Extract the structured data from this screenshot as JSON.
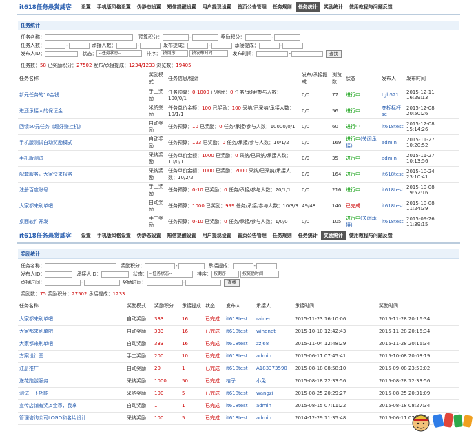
{
  "nav1": {
    "logo": "it618任务悬赏威客",
    "items": [
      "设置",
      "手机版风格设置",
      "伪静态设置",
      "短信提醒设置",
      "用户提现设置",
      "首页公告管理",
      "任务规则",
      "任务统计",
      "奖励统计",
      "使用教程与问题反馈"
    ]
  },
  "task": {
    "section": "任务统计",
    "form": {
      "name": "任务名称：",
      "budget": "预算积分：",
      "reward": "奖励积分：",
      "count": "任务人数：",
      "accepter": "承接人数：",
      "pubcash": "发布提成：",
      "acccash": "承接提成：",
      "pubid": "发布人ID：",
      "status": "状态：",
      "status_sel": "--任务状态--",
      "sort": "排序：",
      "sort_sel": "按倒序",
      "sortby_sel": "按发布时间",
      "pubtime": "发布时间：",
      "search": "查找"
    },
    "summary": {
      "l1": "任务数：",
      "v1": "58",
      "l2": " 已奖励积分：",
      "v2": "27502",
      "l3": " 发布/承接提成：",
      "v3": "1234/1233",
      "l4": " 浏览数：",
      "v4": "19405"
    },
    "headers": [
      "任务名称",
      "奖励模式",
      "任务信息/统计",
      "发布/承接提成",
      "浏览数",
      "状态",
      "发布人",
      "发布时间"
    ],
    "rows": [
      {
        "name": "新元任务的10金钱",
        "mode": "手工奖励",
        "i1": "任务预算：",
        "i2": "0-1000",
        "i3": " 已奖励：",
        "i4": "0",
        "i5": " 任务/承接/参与人数：100/0/1",
        "comm": "0/0",
        "views": "77",
        "status": "进行中",
        "act": "",
        "pub": "tgh521",
        "time": "2015-12-11 16:29:13"
      },
      {
        "name": "进还承接人的保证金",
        "mode": "采纳奖励",
        "i1": "任务单价金额：",
        "i2": "100",
        "i3": " 已奖励：",
        "i4": "100",
        "i5": " 采纳/已采纳/承接人数：10/1/1",
        "comm": "0/0",
        "views": "56",
        "status": "进行中",
        "act": "",
        "pub": "夺标标杆se",
        "time": "2015-12-08 20:50:26"
      },
      {
        "name": "回馈50元任务《超好赚挂机》",
        "mode": "自动奖励",
        "i1": "任务预算：",
        "i2": "10",
        "i3": " 已奖励：",
        "i4": "0",
        "i5": " 任务/承接/参与人数：10000/0/1",
        "comm": "0/0",
        "views": "60",
        "status": "进行中",
        "act": "",
        "pub": "it618test",
        "time": "2015-12-08 15:14:26"
      },
      {
        "name": "手机版测试自动奖励模式",
        "mode": "自动奖励",
        "i1": "任务预算：",
        "i2": "123",
        "i3": " 已奖励：",
        "i4": "0",
        "i5": " 任务/承接/参与人数：10/1/2",
        "comm": "0/0",
        "views": "169",
        "status": "进行中",
        "act": "(关闭承接)",
        "pub": "admin",
        "time": "2015-11-27 10:20:52"
      },
      {
        "name": "手机版测试",
        "mode": "采纳奖励",
        "i1": "任务单价金额：",
        "i2": "1000",
        "i3": " 已奖励：",
        "i4": "0",
        "i5": " 采纳/已采纳/承接人数：10/0/1",
        "comm": "0/0",
        "views": "35",
        "status": "进行中",
        "act": "",
        "pub": "admin",
        "time": "2015-11-27 10:13:56"
      },
      {
        "name": "配套服务，大家快来报名",
        "mode": "采纳奖励",
        "i1": "任务单价金额：",
        "i2": "1000",
        "i3": " 已奖励：",
        "i4": "2000",
        "i5": " 采纳/已采纳/承接人数：10/2/3",
        "comm": "0/0",
        "views": "164",
        "status": "进行中",
        "act": "",
        "pub": "it618test",
        "time": "2015-10-24 23:10:41"
      },
      {
        "name": "注册百度账号",
        "mode": "手工奖励",
        "i1": "任务预算：",
        "i2": "0-10",
        "i3": " 已奖励：",
        "i4": "0",
        "i5": " 任务/承接/参与人数：20/1/1",
        "comm": "0/0",
        "views": "216",
        "status": "进行中",
        "act": "",
        "pub": "it618test",
        "time": "2015-10-08 19:52:16"
      },
      {
        "name": "大家都来刷单吧",
        "mode": "自动奖励",
        "i1": "任务预算：",
        "i2": "1000",
        "i3": " 已奖励：",
        "i4": "999",
        "i5": " 任务/承接/参与人数：10/3/3",
        "comm": "49/48",
        "views": "140",
        "status": "已完成",
        "act": "",
        "pub": "it618test",
        "time": "2015-10-08 11:24:39"
      },
      {
        "name": "桌面软件开发",
        "mode": "手工奖励",
        "i1": "任务预算：",
        "i2": "0-10",
        "i3": " 已奖励：",
        "i4": "0",
        "i5": " 任务/承接/参与人数：1/0/0",
        "comm": "0/0",
        "views": "105",
        "status": "进行中",
        "act": "(关闭承接)",
        "pub": "it618test",
        "time": "2015-09-26 11:39:15"
      }
    ]
  },
  "nav2": {
    "logo": "it618任务悬赏威客",
    "items": [
      "设置",
      "手机版风格设置",
      "伪静态设置",
      "短信提醒设置",
      "用户提现设置",
      "首页公告管理",
      "任务规则",
      "任务统计",
      "奖励统计",
      "使用教程与问题反馈"
    ]
  },
  "reward": {
    "section": "奖励统计",
    "form": {
      "name": "任务名称：",
      "reward": "奖励积分：",
      "acccash": "承接提成：",
      "pubid": "发布人ID：",
      "accid": "承接人ID：",
      "status": "状态：",
      "status_sel": "--任务状态--",
      "sort": "排序：",
      "sort_sel": "按倒序",
      "sortby_sel": "按奖励时间",
      "acctime": "承接时间：",
      "rewtime": "奖励时间：",
      "search": "查找"
    },
    "summary": {
      "l1": "奖励数：",
      "v1": "75",
      "l2": " 奖励积分：",
      "v2": "27502",
      "l3": " 承接提成：",
      "v3": "1233"
    },
    "headers": [
      "任务名称",
      "奖励模式",
      "奖励积分",
      "承接提成",
      "状态",
      "发布人",
      "承接人",
      "承接时间",
      "奖励时间"
    ],
    "rows": [
      {
        "name": "大家都来刷单吧",
        "mode": "自动奖励",
        "pts": "333",
        "cash": "16",
        "status": "已完成",
        "pub": "it618test",
        "acc": "rainer",
        "t1": "2015-11-23 16:10:06",
        "t2": "2015-11-28 20:16:34"
      },
      {
        "name": "大家都来刷单吧",
        "mode": "自动奖励",
        "pts": "333",
        "cash": "16",
        "status": "已完成",
        "pub": "it618test",
        "acc": "windnet",
        "t1": "2015-10-10 12:42:43",
        "t2": "2015-11-28 20:16:34"
      },
      {
        "name": "大家都来刷单吧",
        "mode": "自动奖励",
        "pts": "333",
        "cash": "16",
        "status": "已完成",
        "pub": "it618test",
        "acc": "zzj68",
        "t1": "2015-11-04 12:48:29",
        "t2": "2015-11-28 20:16:34"
      },
      {
        "name": "方案设计图",
        "mode": "手工奖励",
        "pts": "200",
        "cash": "10",
        "status": "已完成",
        "pub": "it618test",
        "acc": "admin",
        "t1": "2015-06-11 07:45:41",
        "t2": "2015-10-08 20:03:19"
      },
      {
        "name": "注册推广",
        "mode": "自动奖励",
        "pts": "20",
        "cash": "1",
        "status": "已完成",
        "pub": "it618test",
        "acc": "A183373590",
        "t1": "2015-08-18 08:58:10",
        "t2": "2015-09-08 23:50:02"
      },
      {
        "name": "送花跑腿服务",
        "mode": "采纳奖励",
        "pts": "1000",
        "cash": "50",
        "status": "已完成",
        "pub": "桔子",
        "acc": "小兔",
        "t1": "2015-08-18 22:33:56",
        "t2": "2015-08-28 12:33:56"
      },
      {
        "name": "测试一下功能",
        "mode": "采纳奖励",
        "pts": "100",
        "cash": "5",
        "status": "已完成",
        "pub": "it618test",
        "acc": "wangzi",
        "t1": "2015-08-25 20:29:27",
        "t2": "2015-08-25 20:31:09"
      },
      {
        "name": "宣传店铺有奖,5金币，我拿",
        "mode": "自动奖励",
        "pts": "1",
        "cash": "1",
        "status": "已完成",
        "pub": "it618test",
        "acc": "admin",
        "t1": "2015-08-15 07:11:22",
        "t2": "2015-08-18 08:27:34"
      },
      {
        "name": "管理咨询公司LOGO和名片设计",
        "mode": "采纳奖励",
        "pts": "100",
        "cash": "5",
        "status": "已完成",
        "pub": "it618test",
        "acc": "admin",
        "t1": "2014-12-29 11:35:48",
        "t2": "2015-06-11 07:07:31"
      }
    ]
  },
  "colors": {
    "accent": "#2a5fb0",
    "red": "#cc0000",
    "green": "#009900",
    "section_bg": "#eaf2fa"
  }
}
